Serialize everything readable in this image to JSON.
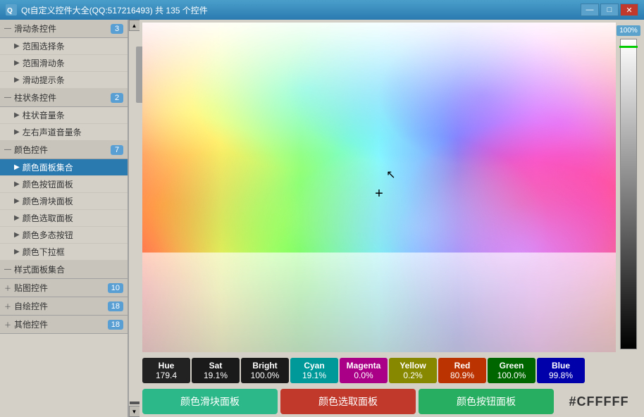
{
  "titlebar": {
    "title": "Qt自定义控件大全(QQ:517216493) 共 135 个控件",
    "min_btn": "—",
    "max_btn": "□",
    "close_btn": "✕"
  },
  "sidebar": {
    "groups": [
      {
        "id": "slider-group",
        "label": "滑动条控件",
        "badge": "3",
        "expanded": true,
        "icon": "minus",
        "items": [
          {
            "label": "范围选择条",
            "icon": "▶"
          },
          {
            "label": "范围滑动条",
            "icon": "▶"
          },
          {
            "label": "滑动提示条",
            "icon": "▶"
          }
        ]
      },
      {
        "id": "column-group",
        "label": "柱状条控件",
        "badge": "2",
        "expanded": true,
        "icon": "minus",
        "items": [
          {
            "label": "柱状音量条",
            "icon": "▶"
          },
          {
            "label": "左右声道音量条",
            "icon": "▶"
          }
        ]
      },
      {
        "id": "color-group",
        "label": "颜色控件",
        "badge": "7",
        "expanded": true,
        "icon": "minus",
        "items": [
          {
            "label": "颜色面板集合",
            "icon": "▶",
            "active": true
          },
          {
            "label": "颜色按钮面板",
            "icon": "▶"
          },
          {
            "label": "颜色滑块面板",
            "icon": "▶"
          },
          {
            "label": "颜色选取面板",
            "icon": "▶"
          },
          {
            "label": "颜色多态按钮",
            "icon": "▶"
          },
          {
            "label": "颜色下拉框",
            "icon": "▶"
          }
        ]
      },
      {
        "id": "style-group",
        "label": "样式面板集合",
        "badge": "",
        "expanded": false,
        "icon": "minus",
        "items": []
      },
      {
        "id": "image-group",
        "label": "贴图控件",
        "badge": "10",
        "expanded": false,
        "icon": "plus",
        "items": []
      },
      {
        "id": "draw-group",
        "label": "自绘控件",
        "badge": "18",
        "expanded": false,
        "icon": "plus",
        "items": []
      },
      {
        "id": "other-group",
        "label": "其他控件",
        "badge": "18",
        "expanded": false,
        "icon": "plus",
        "items": []
      }
    ]
  },
  "color_panel": {
    "brightness_label": "100%",
    "values": {
      "hue_label": "Hue",
      "hue_value": "179.4",
      "sat_label": "Sat",
      "sat_value": "19.1%",
      "bright_label": "Bright",
      "bright_value": "100.0%",
      "cyan_label": "Cyan",
      "cyan_value": "19.1%",
      "magenta_label": "Magenta",
      "magenta_value": "0.0%",
      "yellow_label": "Yellow",
      "yellow_value": "0.2%",
      "red_label": "Red",
      "red_value": "80.9%",
      "green_label": "Green",
      "green_value": "100.0%",
      "blue_label": "Blue",
      "blue_value": "99.8%"
    }
  },
  "bottom_buttons": {
    "slider_label": "颜色滑块面板",
    "selector_label": "颜色选取面板",
    "buttons_label": "颜色按钮面板",
    "hex_value": "#CFFFFF"
  }
}
